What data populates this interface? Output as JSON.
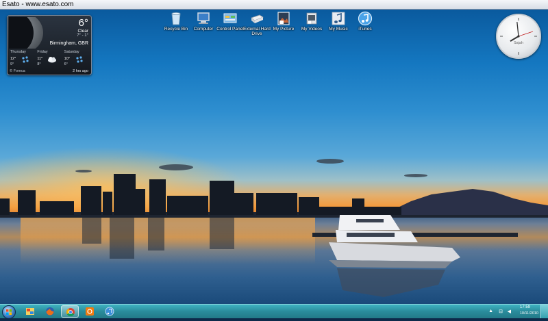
{
  "window": {
    "title": "Esato - www.esato.com"
  },
  "desktop_icons": [
    {
      "label": "Recycle Bin",
      "icon": "recycle-bin-icon"
    },
    {
      "label": "Computer",
      "icon": "computer-icon"
    },
    {
      "label": "Control Panel",
      "icon": "control-panel-icon"
    },
    {
      "label": "External Hard Drive",
      "icon": "external-drive-icon"
    },
    {
      "label": "My Picture",
      "icon": "pictures-icon"
    },
    {
      "label": "My Videos",
      "icon": "videos-icon"
    },
    {
      "label": "My Music",
      "icon": "music-icon"
    },
    {
      "label": "iTunes",
      "icon": "itunes-icon"
    }
  ],
  "weather": {
    "temp": "6°",
    "condition": "Clear",
    "hilo": "7° - 1°",
    "city": "Birmingham, GBR",
    "days": [
      {
        "name": "Thursday",
        "hi": "12°",
        "lo": "9°",
        "icon": "rain-icon"
      },
      {
        "name": "Friday",
        "hi": "11°",
        "lo": "8°",
        "icon": "cloud-icon"
      },
      {
        "name": "Saturday",
        "hi": "10°",
        "lo": "6°",
        "icon": "rain-icon"
      }
    ],
    "source": "© Foreca",
    "updated": "2 hrs ago"
  },
  "clock": {
    "label": "Sajah",
    "hour": 7,
    "minute": 59
  },
  "taskbar": {
    "items": [
      {
        "name": "paint-icon",
        "color": "#e8a020"
      },
      {
        "name": "firefox-icon",
        "color": "#e05a1a"
      },
      {
        "name": "chrome-icon",
        "color": "#3aa14a"
      },
      {
        "name": "media-player-icon",
        "color": "#f07a10"
      },
      {
        "name": "itunes-taskbar-icon",
        "color": "#3a8fd8"
      }
    ],
    "time": "17:59",
    "date": "10/11/2010"
  }
}
